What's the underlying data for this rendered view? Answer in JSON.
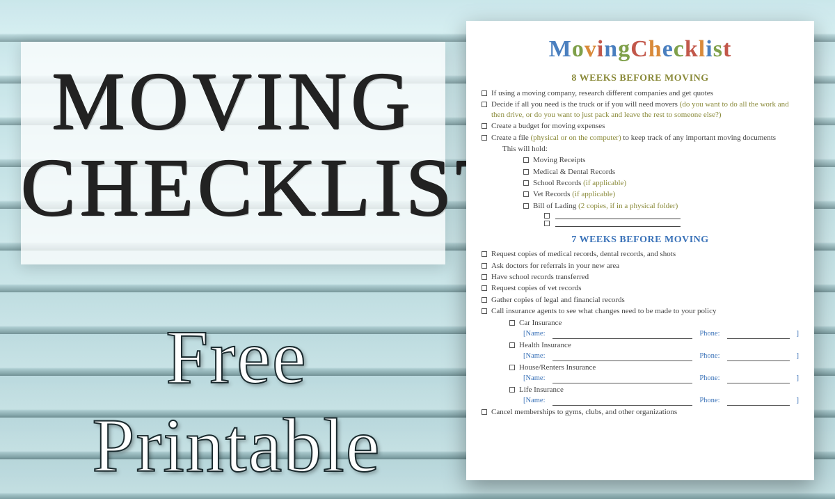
{
  "background": {
    "style": "light-blue-wood-slats"
  },
  "hero": {
    "title_line1": "MOVING",
    "title_line2": "CHECKLIST",
    "subtitle": "Free Printable"
  },
  "sheet": {
    "title_word1": "Moving",
    "title_word2": "Checklist",
    "title_letter_colors": [
      "blue",
      "green",
      "orange",
      "red",
      "blue",
      "green",
      "red",
      "orange",
      "blue",
      "green",
      "red",
      "orange",
      "blue",
      "green",
      "red"
    ],
    "sections": [
      {
        "id": "8weeks",
        "heading": "8 WEEKS BEFORE MOVING",
        "heading_color": "olive",
        "items": [
          {
            "text": "If using a moving company, research different companies and get quotes"
          },
          {
            "text": "Decide if all you need is the truck or if you will need movers",
            "note": "(do you want to do all the work and then drive, or do you want to just pack and leave the rest to someone else?)"
          },
          {
            "text": "Create a budget for moving expenses"
          },
          {
            "text": "Create a file",
            "note_inline": "(physical or on the computer)",
            "text_after": " to keep track of any important moving documents",
            "subtext": "This will hold:",
            "subitems": [
              {
                "text": "Moving Receipts"
              },
              {
                "text": "Medical & Dental Records"
              },
              {
                "text": "School Records",
                "note": "(if applicable)"
              },
              {
                "text": "Vet Records",
                "note": "(if applicable)"
              },
              {
                "text": "Bill of Lading",
                "note": "(2 copies, if in a physical folder)"
              }
            ],
            "blanks": 2
          }
        ]
      },
      {
        "id": "7weeks",
        "heading": "7 WEEKS BEFORE MOVING",
        "heading_color": "blue",
        "items": [
          {
            "text": "Request copies of medical records, dental records, and shots"
          },
          {
            "text": "Ask doctors for referrals in your new area"
          },
          {
            "text": "Have school records transferred"
          },
          {
            "text": "Request copies of vet records"
          },
          {
            "text": "Gather copies of legal and financial records"
          },
          {
            "text": "Call insurance agents to see what changes need to be made to your policy",
            "insurances": [
              {
                "name": "Car Insurance"
              },
              {
                "name": "Health Insurance"
              },
              {
                "name": "House/Renters Insurance"
              },
              {
                "name": "Life Insurance"
              }
            ],
            "field_name_label": "[Name:",
            "field_phone_label": "Phone:",
            "field_close": "]"
          },
          {
            "text": "Cancel memberships to gyms, clubs, and other organizations"
          }
        ]
      }
    ]
  }
}
